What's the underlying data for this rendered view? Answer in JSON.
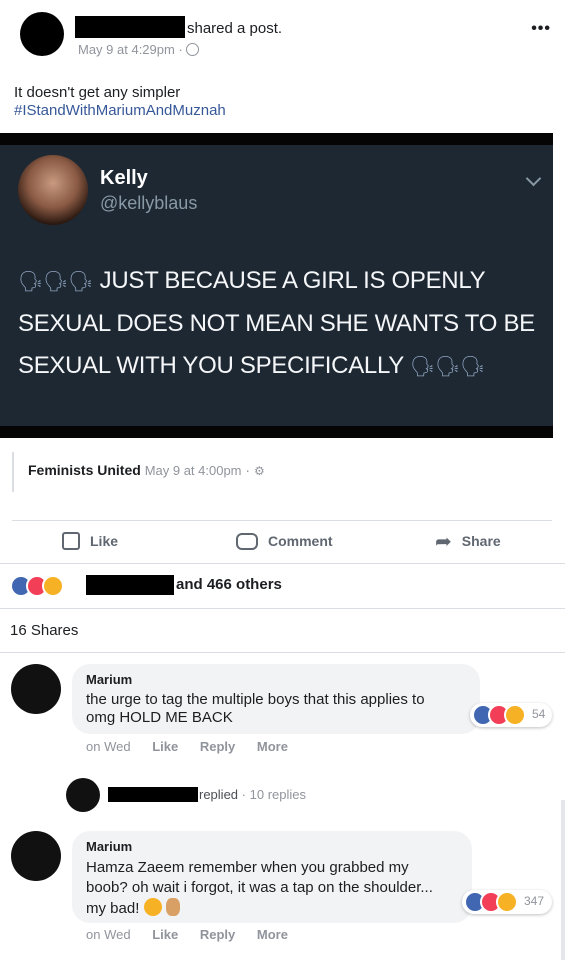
{
  "post": {
    "shared_label": "shared a post.",
    "date": "May 9 at 4:29pm",
    "separator": "·",
    "more_icon": "•••",
    "caption": "It doesn't get any simpler",
    "hashtag": "#IStandWithMariumAndMuznah"
  },
  "tweet": {
    "name": "Kelly",
    "handle": "@kellyblaus",
    "text": "JUST BECAUSE A GIRL IS OPENLY SEXUAL DOES NOT MEAN SHE WANTS TO BE SEXUAL WITH YOU SPECIFICALLY"
  },
  "source": {
    "page": "Feminists United",
    "date": "May 9 at 4:00pm",
    "separator": "·"
  },
  "actions": {
    "like": "Like",
    "comment": "Comment",
    "share": "Share"
  },
  "reactions": {
    "others": "and 466 others",
    "shares": "16 Shares"
  },
  "comments": [
    {
      "author": "Marium",
      "text": "the urge to tag the multiple boys that this applies to omg HOLD ME BACK",
      "count": "54",
      "time": "on Wed",
      "like": "Like",
      "reply": "Reply",
      "more": "More"
    },
    {
      "author": "Marium",
      "text": "Hamza Zaeem remember when you grabbed my boob? oh wait i forgot, it was a tap on the shoulder... my bad!",
      "count": "347",
      "time": "on Wed",
      "like": "Like",
      "reply": "Reply",
      "more": "More"
    }
  ],
  "reply_summary": {
    "replied": "replied",
    "separator": "·",
    "count": "10 replies"
  },
  "colors": {
    "fb_blue": "#4267b2",
    "love_red": "#f33e58",
    "haha_yellow": "#f7b125",
    "tweet_bg": "#1e2833"
  }
}
